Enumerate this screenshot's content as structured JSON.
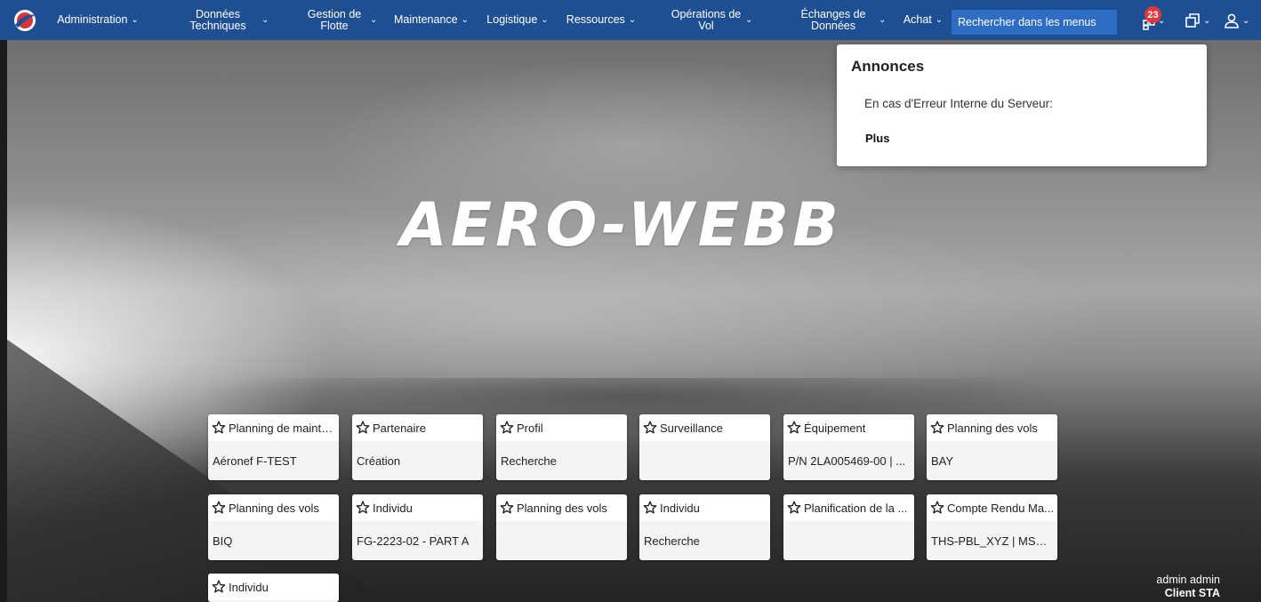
{
  "nav": {
    "items": [
      {
        "label": "Administration"
      },
      {
        "label": "Données Techniques"
      },
      {
        "label": "Gestion de Flotte"
      },
      {
        "label": "Maintenance"
      },
      {
        "label": "Logistique"
      },
      {
        "label": "Ressources"
      },
      {
        "label": "Opérations de Vol"
      },
      {
        "label": "Échanges de Données"
      },
      {
        "label": "Achat"
      }
    ],
    "search_placeholder": "Rechercher dans les menus",
    "notifications_count": "23",
    "chevron": "⌄"
  },
  "brand": "AERO-WEBB",
  "announcements": {
    "title": "Annonces",
    "message": "En cas d'Erreur Interne du Serveur:",
    "more": "Plus"
  },
  "tiles": [
    {
      "title": "Planning de mainte...",
      "subtitle": "Aéronef F-TEST"
    },
    {
      "title": "Partenaire",
      "subtitle": "Création"
    },
    {
      "title": "Profil",
      "subtitle": "Recherche"
    },
    {
      "title": "Surveillance",
      "subtitle": ""
    },
    {
      "title": "Équipement",
      "subtitle": "P/N 2LA005469-00 | ..."
    },
    {
      "title": "Planning des vols",
      "subtitle": "BAY"
    },
    {
      "title": "Planning des vols",
      "subtitle": "BIQ"
    },
    {
      "title": "Individu",
      "subtitle": "FG-2223-02 - PART A"
    },
    {
      "title": "Planning des vols",
      "subtitle": ""
    },
    {
      "title": "Individu",
      "subtitle": "Recherche"
    },
    {
      "title": "Planification de la ...",
      "subtitle": ""
    },
    {
      "title": "Compte Rendu Ma...",
      "subtitle": "THS-PBL_XYZ | MSN ..."
    },
    {
      "title": "Individu",
      "subtitle": ""
    }
  ],
  "user": {
    "name": "admin admin",
    "client": "Client STA"
  },
  "colors": {
    "navbar": "#1f4f93",
    "search_bg": "#2f6cc4",
    "badge": "#e5363c"
  }
}
